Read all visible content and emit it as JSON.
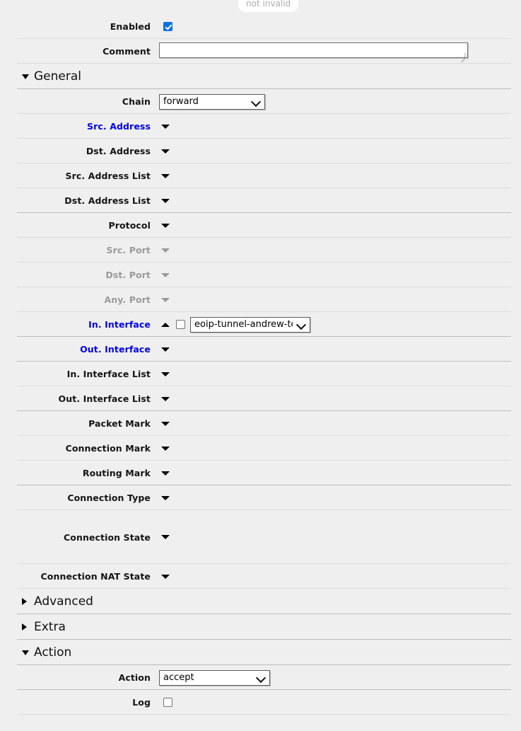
{
  "status": {
    "badge": "not invalid"
  },
  "top": {
    "enabled_label": "Enabled",
    "comment_label": "Comment",
    "comment_value": "",
    "comment_placeholder": ""
  },
  "sections": {
    "general": "General",
    "advanced": "Advanced",
    "extra": "Extra",
    "action": "Action"
  },
  "general": {
    "chain_label": "Chain",
    "chain_value": "forward",
    "chain_options": [
      "forward"
    ],
    "src_address_label": "Src. Address",
    "dst_address_label": "Dst. Address",
    "src_address_list_label": "Src. Address List",
    "dst_address_list_label": "Dst. Address List",
    "protocol_label": "Protocol",
    "src_port_label": "Src. Port",
    "dst_port_label": "Dst. Port",
    "any_port_label": "Any. Port",
    "in_interface_label": "In. Interface",
    "in_interface_value": "eoip-tunnel-andrew-test",
    "in_interface_options": [
      "eoip-tunnel-andrew-test"
    ],
    "out_interface_label": "Out. Interface",
    "in_interface_list_label": "In. Interface List",
    "out_interface_list_label": "Out. Interface List",
    "packet_mark_label": "Packet Mark",
    "connection_mark_label": "Connection Mark",
    "routing_mark_label": "Routing Mark",
    "connection_type_label": "Connection Type",
    "connection_state_label": "Connection State",
    "connection_nat_state_label": "Connection NAT State"
  },
  "action": {
    "action_label": "Action",
    "action_value": "accept",
    "action_options": [
      "accept"
    ],
    "log_label": "Log"
  },
  "colors": {
    "page_background": "#efefef",
    "link_blue": "#0000ee",
    "disabled_gray": "#9a9a9a",
    "checkbox_accent": "#0a70e8",
    "separator": "#dcdcdc"
  }
}
